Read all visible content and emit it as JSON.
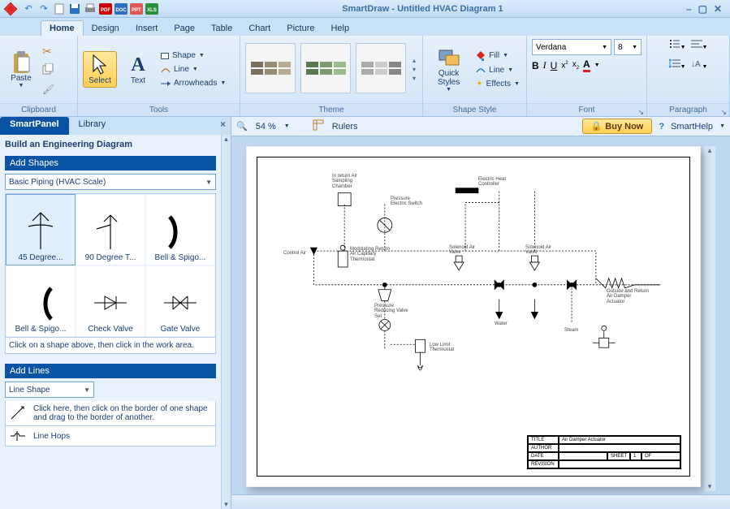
{
  "app": {
    "title": "SmartDraw - Untitled HVAC Diagram 1"
  },
  "qat": [
    "undo",
    "redo",
    "new",
    "save",
    "print",
    "pdf",
    "doc",
    "ppt",
    "xls"
  ],
  "winctl": {
    "min": "–",
    "max": "▢",
    "close": "✕"
  },
  "tabs": [
    "Home",
    "Design",
    "Insert",
    "Page",
    "Table",
    "Chart",
    "Picture",
    "Help"
  ],
  "ribbon": {
    "clipboard": {
      "paste": "Paste",
      "label": "Clipboard"
    },
    "tools": {
      "select": "Select",
      "text": "Text",
      "shape": "Shape",
      "line": "Line",
      "arrowheads": "Arrowheads",
      "label": "Tools"
    },
    "theme": {
      "label": "Theme"
    },
    "shapestyle": {
      "quickstyles": "Quick Styles",
      "fill": "Fill",
      "line": "Line",
      "effects": "Effects",
      "label": "Shape Style"
    },
    "font": {
      "name": "Verdana",
      "size": "8",
      "label": "Font"
    },
    "paragraph": {
      "label": "Paragraph"
    }
  },
  "sidepanel": {
    "tabs": {
      "smart": "SmartPanel",
      "library": "Library"
    },
    "title": "Build an Engineering Diagram",
    "add_shapes_hdr": "Add Shapes",
    "shape_category": "Basic Piping (HVAC Scale)",
    "shapes": [
      "45 Degree...",
      "90 Degree T...",
      "Bell & Spigo...",
      "Bell & Spigo...",
      "Check Valve",
      "Gate Valve"
    ],
    "shape_hint": "Click on a shape above, then click in the work area.",
    "add_lines_hdr": "Add Lines",
    "line_combo": "Line Shape",
    "line_hint": "Click here, then click on the border of one shape and drag to the border of another.",
    "line_hops": "Line Hops"
  },
  "canvas_toolbar": {
    "zoom": "54 %",
    "rulers": "Rulers",
    "buy": "Buy Now",
    "help": "SmartHelp"
  },
  "diagram": {
    "labels": {
      "control_air": "Control Air",
      "sampling": "In return Air Sampling Chamber",
      "modulating": "Modulating Return Air Capillary Thermostat",
      "pressure_switch": "Pressure Electric Switch",
      "pressure_valve": "Pressure Reducing Valve Set",
      "electric_heat": "Electric Heat Controller",
      "solenoid1": "Solenoid Air Valve",
      "solenoid2": "Solenoid Air Valve",
      "water": "Water",
      "steam": "Steam",
      "damper": "Outside and Return Air Damper Actuator",
      "low_limit": "Low Limit Thermostat"
    }
  },
  "titleblock": {
    "title_lbl": "TITLE",
    "title_val": "Air Damper Actuator",
    "author_lbl": "AUTHOR",
    "date_lbl": "DATE",
    "sheet_lbl": "SHEET",
    "sheet_sep": "OF",
    "rev_lbl": "REVISION"
  }
}
